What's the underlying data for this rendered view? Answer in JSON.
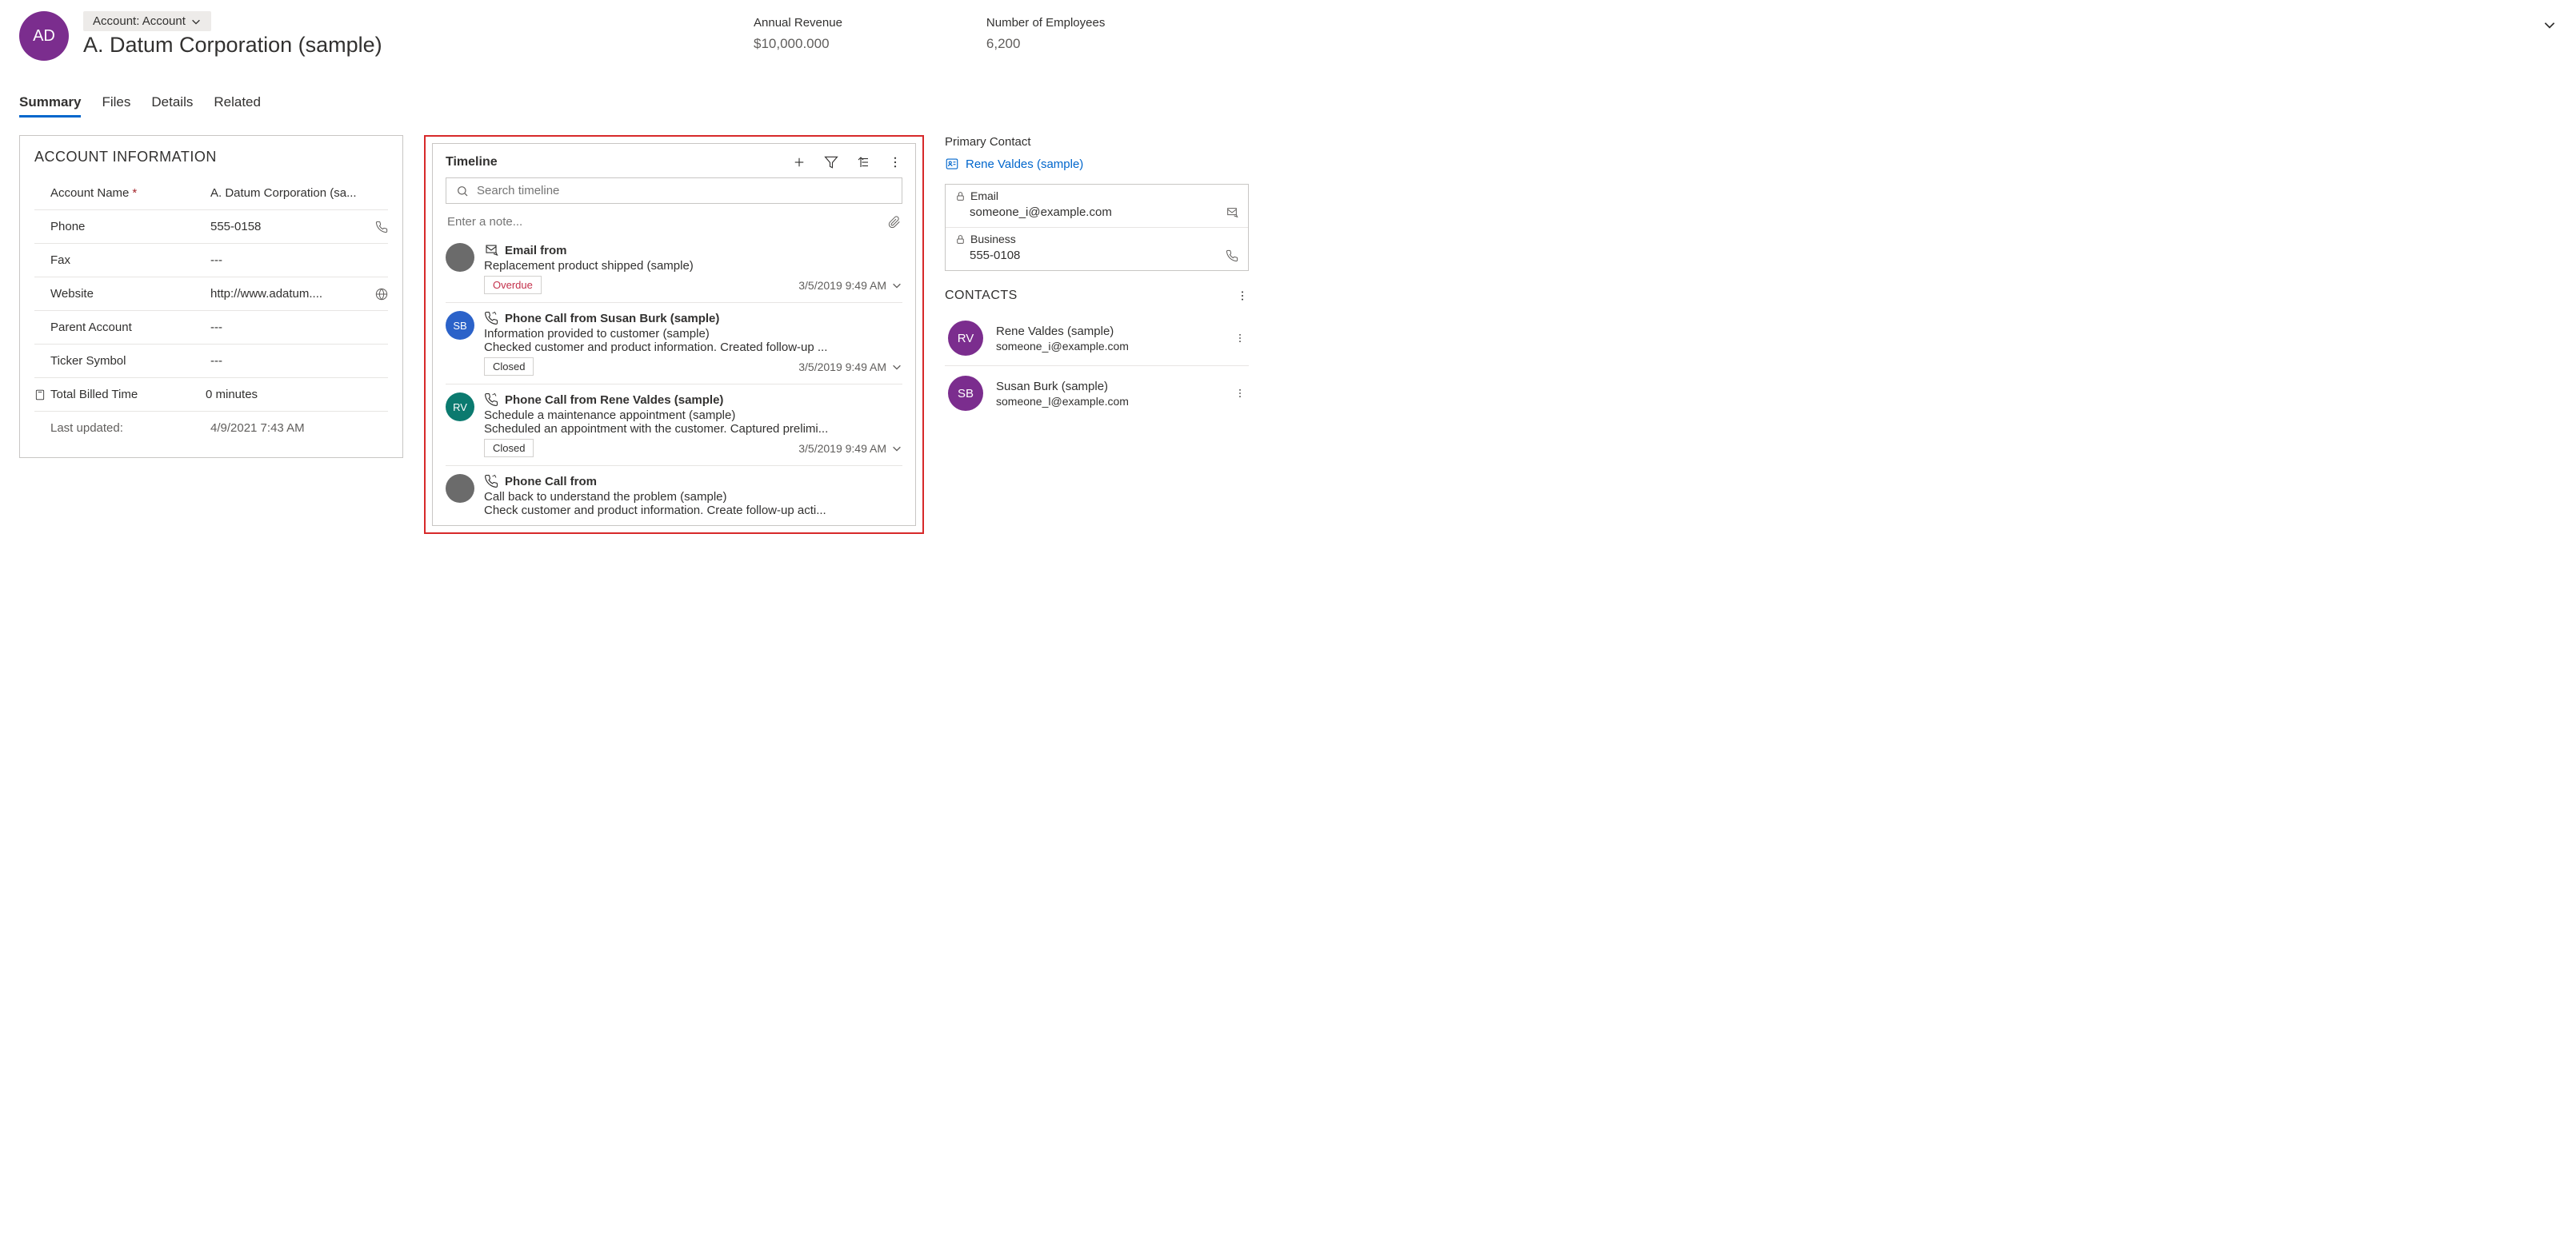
{
  "header": {
    "avatar_initials": "AD",
    "entity_type_label": "Account: Account",
    "entity_title": "A. Datum Corporation (sample)",
    "stats": {
      "revenue_label": "Annual Revenue",
      "revenue_value": "$10,000.000",
      "employees_label": "Number of Employees",
      "employees_value": "6,200"
    }
  },
  "tabs": {
    "summary": "Summary",
    "files": "Files",
    "details": "Details",
    "related": "Related"
  },
  "account_info": {
    "section_title": "ACCOUNT INFORMATION",
    "name_label": "Account Name",
    "name_value": "A. Datum Corporation (sa...",
    "phone_label": "Phone",
    "phone_value": "555-0158",
    "fax_label": "Fax",
    "fax_value": "---",
    "website_label": "Website",
    "website_value": "http://www.adatum....",
    "parent_label": "Parent Account",
    "parent_value": "---",
    "ticker_label": "Ticker Symbol",
    "ticker_value": "---",
    "billed_label": "Total Billed Time",
    "billed_value": "0 minutes",
    "updated_label": "Last updated:",
    "updated_value": "4/9/2021 7:43 AM"
  },
  "timeline": {
    "title": "Timeline",
    "search_placeholder": "Search timeline",
    "note_placeholder": "Enter a note...",
    "items": [
      {
        "avatar_initials": "",
        "avatar_class": "avatar-grey",
        "activity_type": "Email from",
        "icon": "email",
        "subject": "Replacement product shipped (sample)",
        "description": "",
        "tag": "Overdue",
        "tag_class": "overdue",
        "date": "3/5/2019 9:49 AM"
      },
      {
        "avatar_initials": "SB",
        "avatar_class": "avatar-blue",
        "activity_type": "Phone Call from Susan Burk (sample)",
        "icon": "phone",
        "subject": "Information provided to customer (sample)",
        "description": "Checked customer and product information. Created follow-up ...",
        "tag": "Closed",
        "tag_class": "",
        "date": "3/5/2019 9:49 AM"
      },
      {
        "avatar_initials": "RV",
        "avatar_class": "avatar-teal",
        "activity_type": "Phone Call from Rene Valdes (sample)",
        "icon": "phone",
        "subject": "Schedule a maintenance appointment (sample)",
        "description": "Scheduled an appointment with the customer. Captured prelimi...",
        "tag": "Closed",
        "tag_class": "",
        "date": "3/5/2019 9:49 AM"
      },
      {
        "avatar_initials": "",
        "avatar_class": "avatar-grey",
        "activity_type": "Phone Call from",
        "icon": "phone",
        "subject": "Call back to understand the problem (sample)",
        "description": "Check customer and product information. Create follow-up acti...",
        "tag": "",
        "tag_class": "",
        "date": ""
      }
    ]
  },
  "primary_contact": {
    "heading": "Primary Contact",
    "name": "Rene Valdes (sample)",
    "email_label": "Email",
    "email_value": "someone_i@example.com",
    "business_label": "Business",
    "business_value": "555-0108"
  },
  "contacts": {
    "heading": "CONTACTS",
    "list": [
      {
        "initials": "RV",
        "avatar_class": "avatar-purple",
        "name": "Rene Valdes (sample)",
        "email": "someone_i@example.com"
      },
      {
        "initials": "SB",
        "avatar_class": "avatar-purple",
        "name": "Susan Burk (sample)",
        "email": "someone_l@example.com"
      }
    ]
  }
}
